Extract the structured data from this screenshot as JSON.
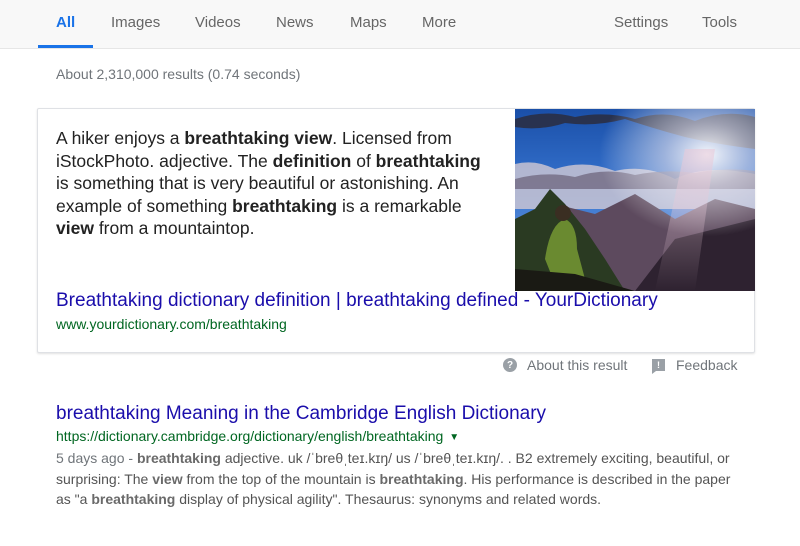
{
  "nav": {
    "tabs": [
      {
        "label": "All",
        "active": true
      },
      {
        "label": "Images"
      },
      {
        "label": "Videos"
      },
      {
        "label": "News"
      },
      {
        "label": "Maps"
      },
      {
        "label": "More"
      }
    ],
    "settings_label": "Settings",
    "tools_label": "Tools",
    "accent_color": "#1a73e8"
  },
  "stats": "About 2,310,000 results (0.74 seconds)",
  "featured": {
    "snippet_parts": [
      {
        "t": "A hiker enjoys a "
      },
      {
        "t": "breathtaking view",
        "b": true
      },
      {
        "t": ". Licensed from iStockPhoto. adjective. The "
      },
      {
        "t": "definition",
        "b": true
      },
      {
        "t": " of "
      },
      {
        "t": "breathtaking",
        "b": true
      },
      {
        "t": " is something that is very beautiful or astonishing. An example of something "
      },
      {
        "t": "breathtaking",
        "b": true
      },
      {
        "t": " is a remarkable "
      },
      {
        "t": "view",
        "b": true
      },
      {
        "t": " from a mountaintop."
      }
    ],
    "image_alt": "hiker sitting on mountain slope viewing sunlit peaks under blue sky with clouds",
    "title": "Breathtaking dictionary definition | breathtaking defined - YourDictionary",
    "url": "www.yourdictionary.com/breathtaking",
    "about_label": "About this result",
    "feedback_label": "Feedback",
    "about_icon": "question-circle-icon",
    "feedback_icon": "feedback-flag-icon"
  },
  "results": [
    {
      "title": "breathtaking Meaning in the Cambridge English Dictionary",
      "url": "https://dictionary.cambridge.org/dictionary/english/breathtaking",
      "caret": "▼",
      "date": "5 days ago - ",
      "snippet_parts": [
        {
          "t": "breathtaking",
          "b": true
        },
        {
          "t": " adjective. uk  /ˈbreθˌteɪ.kɪŋ/ us  /ˈbreθˌteɪ.kɪŋ/. . B2 extremely exciting, beautiful, or surprising: The "
        },
        {
          "t": "view",
          "b": true
        },
        {
          "t": " from the top of the mountain is "
        },
        {
          "t": "breathtaking",
          "b": true
        },
        {
          "t": ". His performance is described in the paper as \"a "
        },
        {
          "t": "breathtaking",
          "b": true
        },
        {
          "t": " display of physical agility\". Thesaurus: synonyms and related words."
        }
      ]
    }
  ],
  "colors": {
    "link": "#1a0dab",
    "url": "#006621",
    "meta": "#70757a"
  }
}
